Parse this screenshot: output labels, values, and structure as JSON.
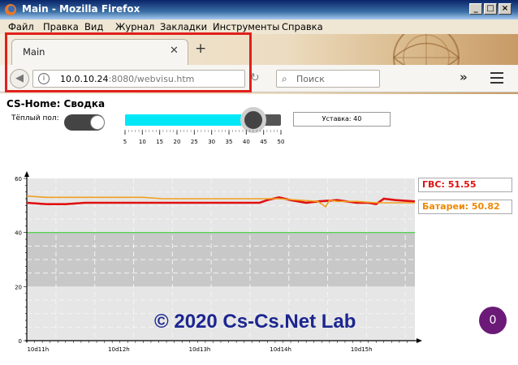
{
  "window": {
    "title": "Main - Mozilla Firefox"
  },
  "menu": {
    "items": [
      "Файл",
      "Правка",
      "Вид",
      "Журнал",
      "Закладки",
      "Инструменты",
      "Справка"
    ]
  },
  "tab": {
    "label": "Main"
  },
  "url": {
    "host": "10.0.10.24",
    "rest": ":8080/webvisu.htm"
  },
  "search": {
    "placeholder": "Поиск"
  },
  "page": {
    "title": "CS-Home: Сводка",
    "toggle_label": "Тёплый пол:",
    "toggle_on": true,
    "setpoint_text": "Уставка: 40",
    "slider": {
      "min": 5,
      "max": 50,
      "value": 42,
      "ticks": [
        5,
        10,
        15,
        20,
        25,
        30,
        35,
        40,
        45,
        50
      ]
    },
    "readout_dhw": "ГВС: 51.55",
    "readout_rad": "Батареи: 50.82",
    "copyright": "© 2020 Cs-Cs.Net Lab",
    "badge": "0"
  },
  "chart_data": {
    "type": "line",
    "ylim": [
      0,
      60
    ],
    "y_ticks": [
      0,
      20,
      40,
      60
    ],
    "x_ticks": [
      "10d11h",
      "10d12h",
      "10d13h",
      "10d14h",
      "10d15h"
    ],
    "x_range": [
      0,
      100
    ],
    "threshold": 40,
    "series": [
      {
        "name": "ГВС",
        "color": "#e01010",
        "x": [
          0,
          5,
          10,
          15,
          20,
          25,
          30,
          35,
          40,
          45,
          50,
          55,
          60,
          62,
          65,
          68,
          72,
          75,
          80,
          85,
          88,
          90,
          92,
          95,
          100
        ],
        "y": [
          51,
          50.5,
          50.5,
          51,
          51,
          51,
          51,
          51,
          51,
          51,
          51,
          51,
          51,
          52,
          53,
          52,
          51,
          51.5,
          52,
          51,
          51,
          50.5,
          52.5,
          52,
          51.5
        ]
      },
      {
        "name": "Батареи",
        "color": "#f0a020",
        "x": [
          0,
          5,
          10,
          15,
          20,
          25,
          30,
          35,
          40,
          45,
          50,
          55,
          60,
          62,
          65,
          70,
          75,
          77,
          78,
          80,
          85,
          90,
          95,
          100
        ],
        "y": [
          53.5,
          53,
          53,
          53,
          53,
          53,
          53,
          52.5,
          52.5,
          52.5,
          52.5,
          52.5,
          52.5,
          52.5,
          52.5,
          52,
          51.5,
          49.5,
          52,
          51.5,
          51.5,
          51,
          51,
          51
        ]
      }
    ]
  }
}
